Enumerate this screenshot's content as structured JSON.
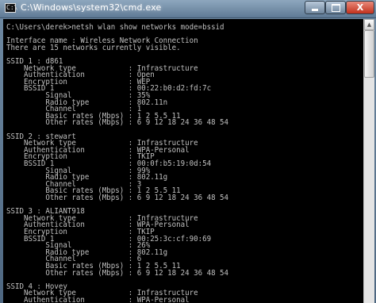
{
  "window": {
    "title": "C:\\Windows\\system32\\cmd.exe",
    "icon_text": "C:\\",
    "minimize_icon": "minimize-icon",
    "maximize_icon": "maximize-icon",
    "close_label": "X"
  },
  "console": {
    "lines": [
      "C:\\Users\\derek>netsh wlan show networks mode=bssid",
      "",
      "Interface name : Wireless Network Connection",
      "There are 15 networks currently visible.",
      "",
      "SSID 1 : d861",
      "    Network type            : Infrastructure",
      "    Authentication          : Open",
      "    Encryption              : WEP",
      "    BSSID 1                 : 00:22:b0:d2:fd:7c",
      "         Signal             : 35%",
      "         Radio type         : 802.11n",
      "         Channel            : 1",
      "         Basic rates (Mbps) : 1 2 5.5 11",
      "         Other rates (Mbps) : 6 9 12 18 24 36 48 54",
      "",
      "SSID 2 : stewart",
      "    Network type            : Infrastructure",
      "    Authentication          : WPA-Personal",
      "    Encryption              : TKIP",
      "    BSSID 1                 : 00:0f:b5:19:0d:54",
      "         Signal             : 99%",
      "         Radio type         : 802.11g",
      "         Channel            : 3",
      "         Basic rates (Mbps) : 1 2 5.5 11",
      "         Other rates (Mbps) : 6 9 12 18 24 36 48 54",
      "",
      "SSID 3 : ALIANT918",
      "    Network type            : Infrastructure",
      "    Authentication          : WPA-Personal",
      "    Encryption              : TKIP",
      "    BSSID 1                 : 00:25:3c:cf:90:69",
      "         Signal             : 26%",
      "         Radio type         : 802.11g",
      "         Channel            : 6",
      "         Basic rates (Mbps) : 1 2 5.5 11",
      "         Other rates (Mbps) : 6 9 12 18 24 36 48 54",
      "",
      "SSID 4 : Hovey",
      "    Network type            : Infrastructure",
      "    Authentication          : WPA-Personal"
    ]
  },
  "scrollbar": {
    "up_arrow": "▲"
  }
}
